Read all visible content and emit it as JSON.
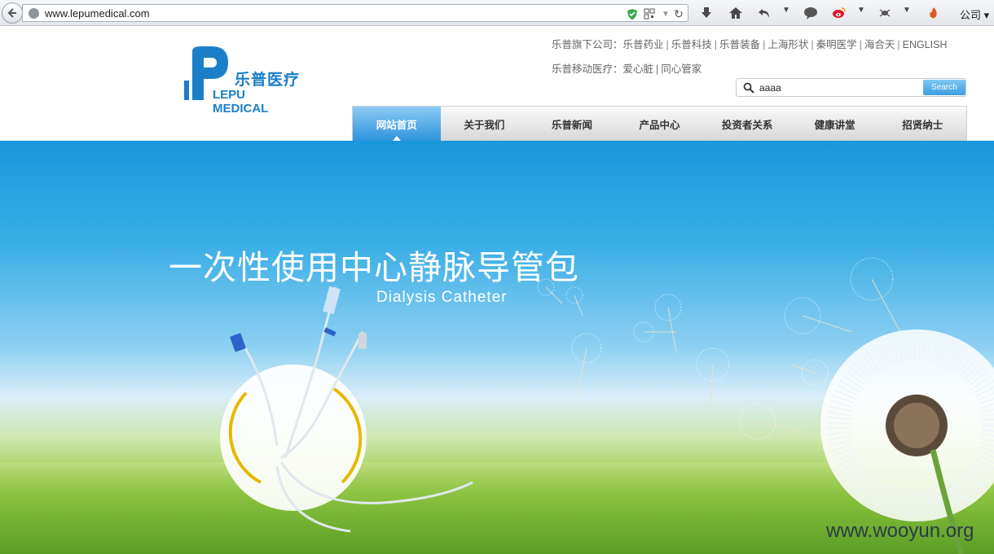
{
  "browser": {
    "url": "www.lepumedical.com",
    "profile_label": "公司"
  },
  "header": {
    "logo_cn": "乐普医疗",
    "logo_en": "LEPU MEDICAL",
    "subsidiaries_prefix": "乐普旗下公司：",
    "subsidiaries": [
      "乐普药业",
      "乐普科技",
      "乐普装备",
      "上海形状",
      "秦明医学",
      "海合天",
      "ENGLISH"
    ],
    "mobile_prefix": "乐普移动医疗：",
    "mobile_links": [
      "爱心脏",
      "同心管家"
    ]
  },
  "search": {
    "value": "aaaa",
    "button_label": "Search"
  },
  "nav": {
    "items": [
      "网站首页",
      "关于我们",
      "乐普新闻",
      "产品中心",
      "投资者关系",
      "健康讲堂",
      "招贤纳士"
    ],
    "active_index": 0
  },
  "banner": {
    "title": "一次性使用中心静脉导管包",
    "subtitle": "Dialysis Catheter",
    "watermark": "www.wooyun.org"
  },
  "colors": {
    "brand": "#1a7fc8",
    "nav_active": "#2f94dc"
  }
}
